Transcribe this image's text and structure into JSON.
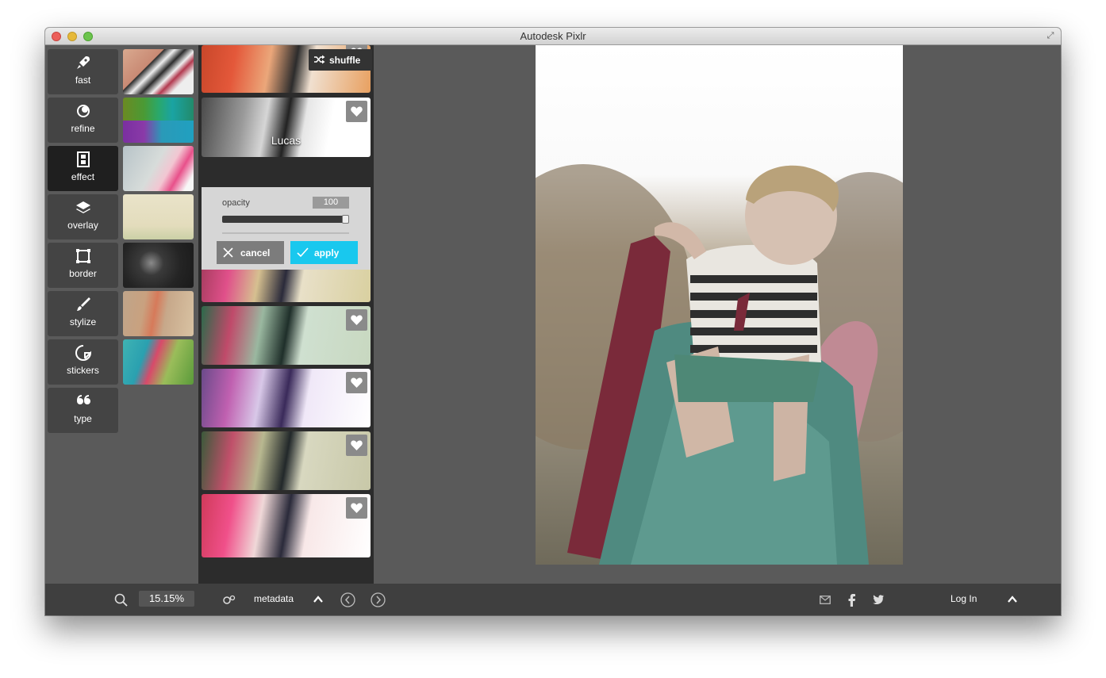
{
  "window": {
    "title": "Autodesk Pixlr"
  },
  "tools": [
    {
      "label": "fast",
      "icon": "rocket-icon"
    },
    {
      "label": "refine",
      "icon": "refine-icon"
    },
    {
      "label": "effect",
      "icon": "film-icon",
      "active": true
    },
    {
      "label": "overlay",
      "icon": "layers-icon"
    },
    {
      "label": "border",
      "icon": "border-icon"
    },
    {
      "label": "stylize",
      "icon": "brush-icon"
    },
    {
      "label": "stickers",
      "icon": "sticker-icon"
    },
    {
      "label": "type",
      "icon": "quote-icon"
    }
  ],
  "effect_panel": {
    "shuffle_label": "shuffle",
    "selected_effect": "Lucas",
    "opacity_label": "opacity",
    "opacity_value": "100",
    "opacity_level": 1.0,
    "cancel_label": "cancel",
    "apply_label": "apply"
  },
  "statusbar": {
    "zoom": "15.15%",
    "metadata_label": "metadata",
    "login_label": "Log In"
  },
  "colors": {
    "accent": "#19c8ee",
    "background": "#5a5a5a",
    "statusbar": "#3f3f3f"
  }
}
